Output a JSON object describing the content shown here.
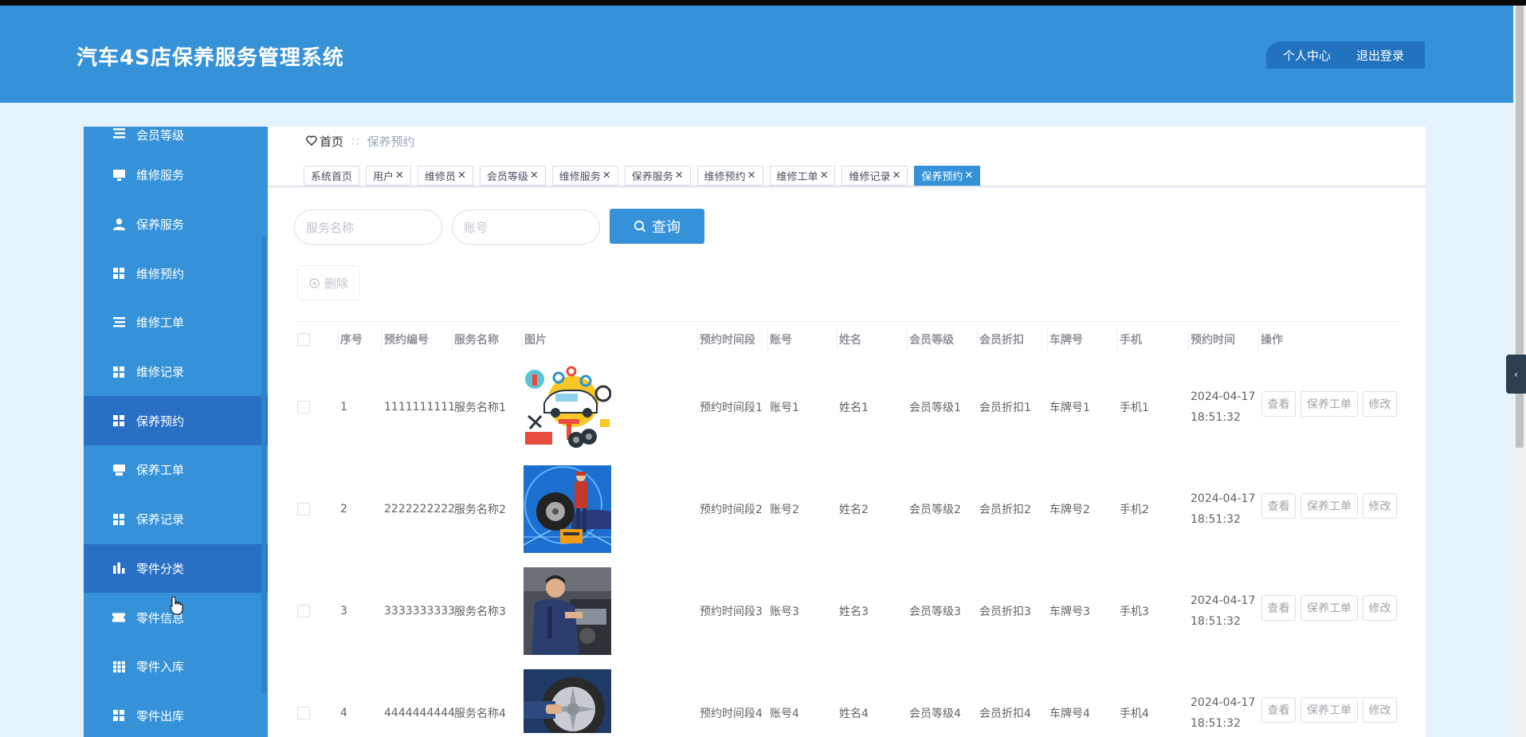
{
  "app": {
    "title": "汽车4S店保养服务管理系统"
  },
  "header": {
    "personal_center": "个人中心",
    "logout": "退出登录"
  },
  "sidebar": {
    "items": [
      {
        "label": "会员等级",
        "icon": "list-icon",
        "active": false
      },
      {
        "label": "维修服务",
        "icon": "monitor-icon",
        "active": false
      },
      {
        "label": "保养服务",
        "icon": "user-icon",
        "active": false
      },
      {
        "label": "维修预约",
        "icon": "grid-icon",
        "active": false
      },
      {
        "label": "维修工单",
        "icon": "list-icon",
        "active": false
      },
      {
        "label": "维修记录",
        "icon": "grid-icon",
        "active": false
      },
      {
        "label": "保养预约",
        "icon": "grid-icon",
        "active": true
      },
      {
        "label": "保养工单",
        "icon": "printer-icon",
        "active": false
      },
      {
        "label": "保养记录",
        "icon": "grid-icon",
        "active": false
      },
      {
        "label": "零件分类",
        "icon": "bar-chart-icon",
        "active": true
      },
      {
        "label": "零件信息",
        "icon": "ticket-icon",
        "active": false
      },
      {
        "label": "零件入库",
        "icon": "table-icon",
        "active": false
      },
      {
        "label": "零件出库",
        "icon": "grid-icon",
        "active": false
      }
    ]
  },
  "breadcrumb": {
    "home": "首页",
    "separator": "∷",
    "current": "保养预约"
  },
  "tabs": [
    {
      "label": "系统首页",
      "closable": false
    },
    {
      "label": "用户",
      "closable": true
    },
    {
      "label": "维修员",
      "closable": true
    },
    {
      "label": "会员等级",
      "closable": true
    },
    {
      "label": "维修服务",
      "closable": true
    },
    {
      "label": "保养服务",
      "closable": true
    },
    {
      "label": "维修预约",
      "closable": true
    },
    {
      "label": "维修工单",
      "closable": true
    },
    {
      "label": "维修记录",
      "closable": true
    },
    {
      "label": "保养预约",
      "closable": true,
      "active": true
    }
  ],
  "search": {
    "service_placeholder": "服务名称",
    "account_placeholder": "账号",
    "query_label": "查询"
  },
  "actions": {
    "delete_label": "删除"
  },
  "table": {
    "columns": [
      "序号",
      "预约编号",
      "服务名称",
      "图片",
      "预约时间段",
      "账号",
      "姓名",
      "会员等级",
      "会员折扣",
      "车牌号",
      "手机",
      "预约时间",
      "操作"
    ],
    "rows": [
      {
        "index": "1",
        "code": "1111111111",
        "service": "服务名称1",
        "slot": "预约时间段1",
        "account": "账号1",
        "name": "姓名1",
        "level": "会员等级1",
        "discount": "会员折扣1",
        "plate": "车牌号1",
        "phone": "手机1",
        "date": "2024-04-17",
        "time": "18:51:32"
      },
      {
        "index": "2",
        "code": "2222222222",
        "service": "服务名称2",
        "slot": "预约时间段2",
        "account": "账号2",
        "name": "姓名2",
        "level": "会员等级2",
        "discount": "会员折扣2",
        "plate": "车牌号2",
        "phone": "手机2",
        "date": "2024-04-17",
        "time": "18:51:32"
      },
      {
        "index": "3",
        "code": "3333333333",
        "service": "服务名称3",
        "slot": "预约时间段3",
        "account": "账号3",
        "name": "姓名3",
        "level": "会员等级3",
        "discount": "会员折扣3",
        "plate": "车牌号3",
        "phone": "手机3",
        "date": "2024-04-17",
        "time": "18:51:32"
      },
      {
        "index": "4",
        "code": "4444444444",
        "service": "服务名称4",
        "slot": "预约时间段4",
        "account": "账号4",
        "name": "姓名4",
        "level": "会员等级4",
        "discount": "会员折扣4",
        "plate": "车牌号4",
        "phone": "手机4",
        "date": "2024-04-17",
        "time": "18:51:32"
      }
    ],
    "op_view": "查看",
    "op_order": "保养工单",
    "op_edit": "修改"
  },
  "colors": {
    "primary": "#3592d9",
    "header_dark": "#2273bf",
    "active_item": "#2a6fc6",
    "page_bg": "#e4f3fd"
  }
}
